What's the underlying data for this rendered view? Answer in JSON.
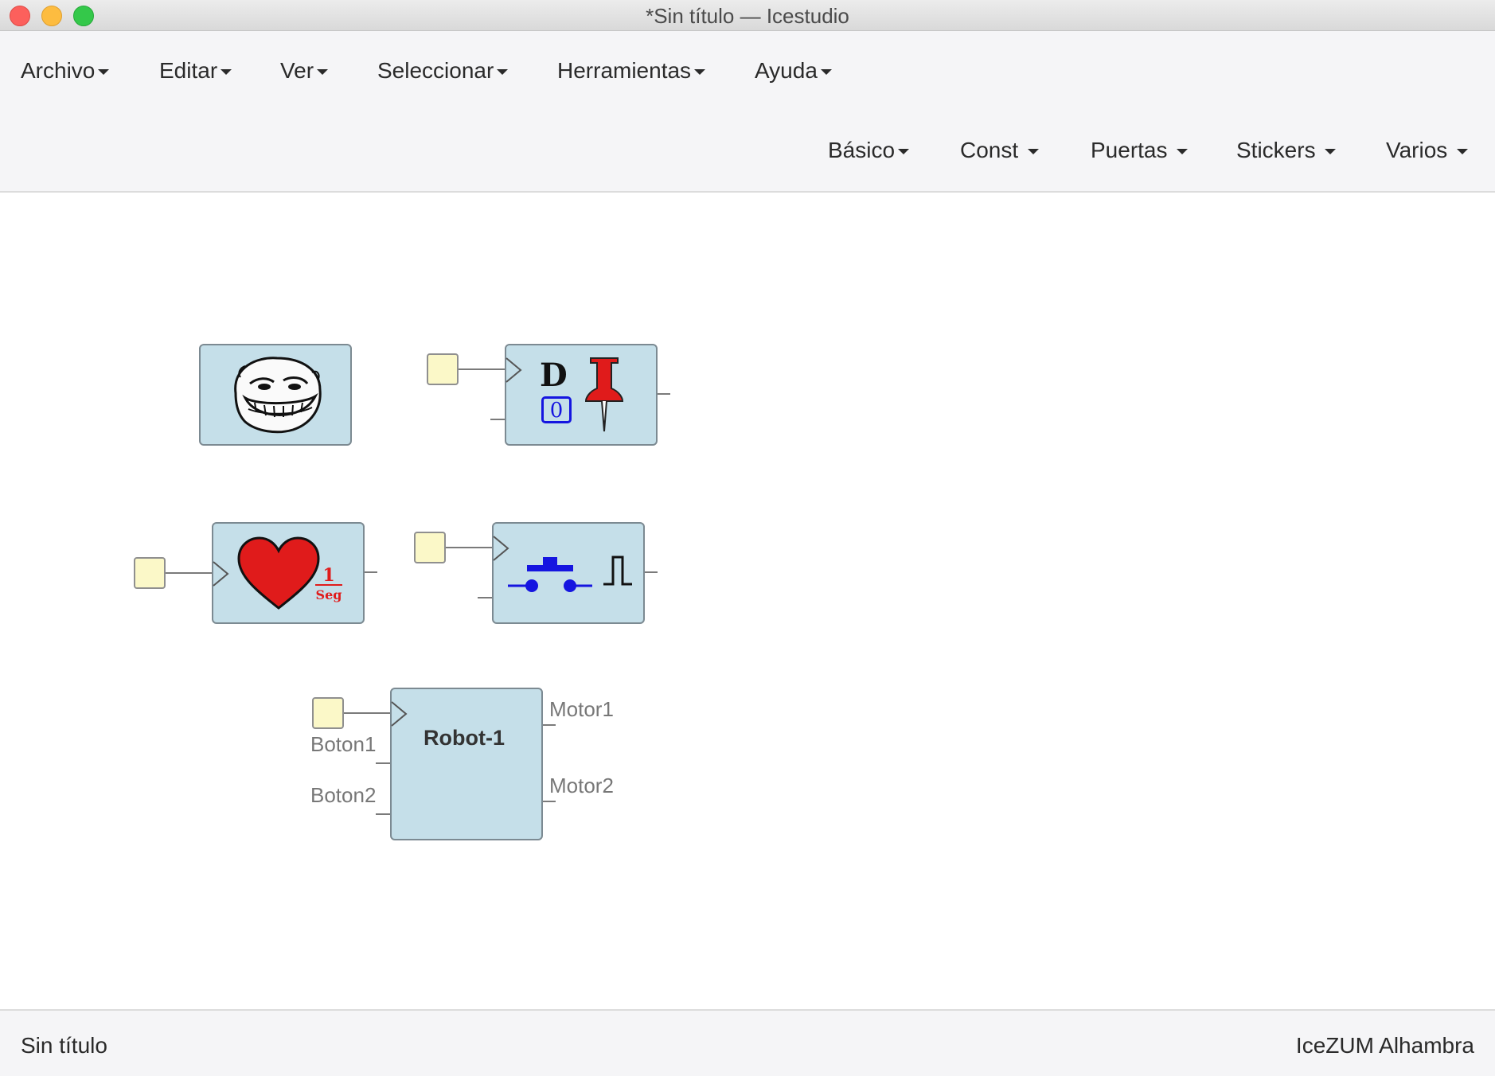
{
  "window": {
    "title": "*Sin título — Icestudio"
  },
  "menu": {
    "main": [
      {
        "label": "Archivo"
      },
      {
        "label": "Editar"
      },
      {
        "label": "Ver"
      },
      {
        "label": "Seleccionar"
      },
      {
        "label": "Herramientas"
      },
      {
        "label": "Ayuda"
      }
    ],
    "blocks": [
      {
        "label": "Básico"
      },
      {
        "label": "Const"
      },
      {
        "label": "Puertas"
      },
      {
        "label": "Stickers"
      },
      {
        "label": "Varios"
      }
    ]
  },
  "canvas": {
    "blocks": [
      {
        "name": "troll-face",
        "icon": "troll-face-icon"
      },
      {
        "name": "d-flipflop-pin",
        "icon_text": "D",
        "value": "0",
        "icon": "pushpin-icon"
      },
      {
        "name": "heartbeat",
        "icon": "heart-icon",
        "numerator": "1",
        "unit": "Seg"
      },
      {
        "name": "button-pulse",
        "icon": "push-button-icon"
      },
      {
        "name": "robot",
        "title": "Robot-1",
        "inputs": [
          "Boton1",
          "Boton2"
        ],
        "outputs": [
          "Motor1",
          "Motor2"
        ]
      }
    ]
  },
  "status": {
    "file": "Sin título",
    "board": "IceZUM Alhambra"
  },
  "colors": {
    "block_fill": "#c5dfe9",
    "block_border": "#7c8a92",
    "input_fill": "#fbf8c8",
    "heart": "#e01b1b",
    "pin": "#e01b1b",
    "button": "#1515e0"
  }
}
